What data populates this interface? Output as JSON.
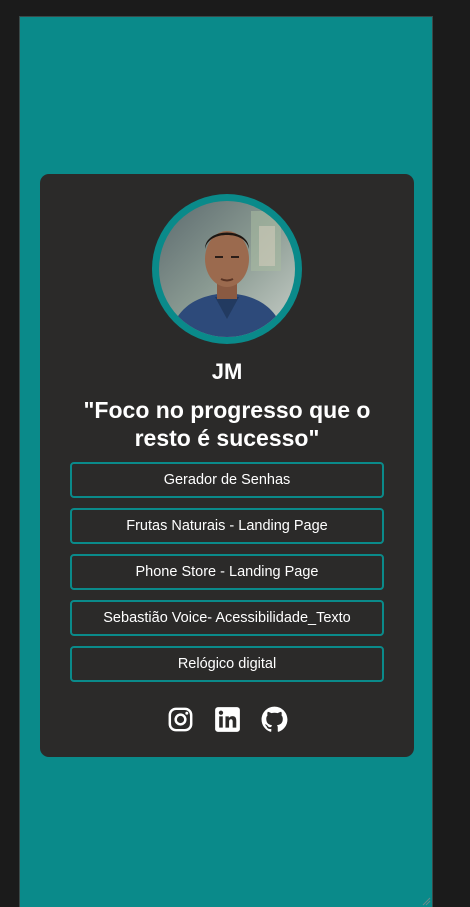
{
  "profile": {
    "name": "JM",
    "quote": "\"Foco no progresso que o resto é sucesso\""
  },
  "links": [
    {
      "label": "Gerador de Senhas"
    },
    {
      "label": "Frutas Naturais - Landing Page"
    },
    {
      "label": "Phone Store - Landing Page"
    },
    {
      "label": "Sebastião Voice- Acessibilidade_Texto"
    },
    {
      "label": "Relógico digital"
    }
  ],
  "socials": [
    {
      "icon": "instagram-icon"
    },
    {
      "icon": "linkedin-icon"
    },
    {
      "icon": "github-icon"
    }
  ],
  "colors": {
    "page_background": "#0a8a8a",
    "card_background": "#2b2a29",
    "accent": "#0a8a8a",
    "text": "#ffffff",
    "outer_frame": "#1b1b1b"
  }
}
